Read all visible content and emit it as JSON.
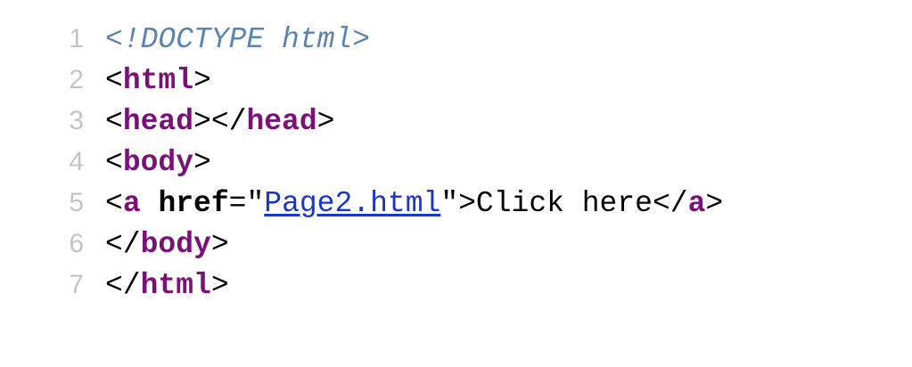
{
  "colors": {
    "line_number": "#c4c4c4",
    "doctype": "#5b84b1",
    "tag": "#7a1178",
    "attribute": "#000000",
    "link": "#1a37c6",
    "text": "#000000",
    "background": "#ffffff"
  },
  "code_lines": [
    {
      "number": "1",
      "doctype": "<!DOCTYPE html>"
    },
    {
      "number": "2",
      "open": "<",
      "tag": "html",
      "close": ">"
    },
    {
      "number": "3",
      "open": "<",
      "tag": "head",
      "mid": "></",
      "tag2": "head",
      "close": ">"
    },
    {
      "number": "4",
      "open": "<",
      "tag": "body",
      "close": ">"
    },
    {
      "number": "5",
      "open": "<",
      "tag": "a",
      "space": " ",
      "attr": "href",
      "equals_quote": "=\"",
      "href_value": "Page2.html",
      "quote_close": "\">",
      "text": "Click here",
      "end_open": "</",
      "end_tag": "a",
      "close": ">"
    },
    {
      "number": "6",
      "open": "</",
      "tag": "body",
      "close": ">"
    },
    {
      "number": "7",
      "open": "</",
      "tag": "html",
      "close": ">"
    }
  ]
}
